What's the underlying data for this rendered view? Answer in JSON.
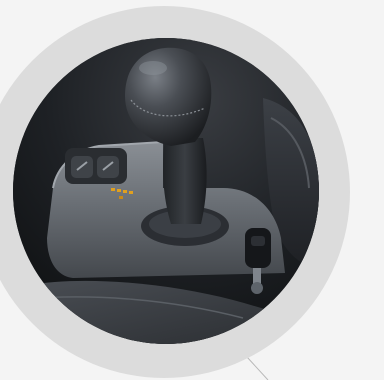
{
  "photo": {
    "subject": "manual-gear-shift-console",
    "colors": {
      "background": "#f4f4f4",
      "ring": "#dcdcdc",
      "interior_dark": "#1f2226",
      "console_grey": "#6b7076",
      "leather": "#3a3e44",
      "indicator_amber": "#e0a020"
    }
  }
}
